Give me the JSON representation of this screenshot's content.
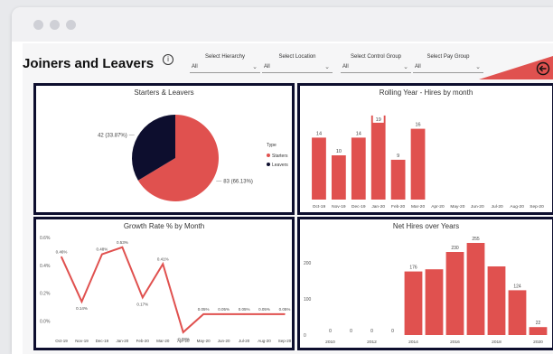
{
  "window": {
    "dot_colors": [
      "#cfd0d6",
      "#cfd0d6",
      "#cfd0d6"
    ]
  },
  "header": {
    "title": "Joiners and Leavers",
    "info_icon": "info-icon",
    "back_icon": "back-arrow-icon",
    "accent": "#e0514f"
  },
  "filters": [
    {
      "label": "Select Hierarchy",
      "value": "All"
    },
    {
      "label": "Select Location",
      "value": "All"
    },
    {
      "label": "Select Control Group",
      "value": "All"
    },
    {
      "label": "Select Pay Group",
      "value": "All"
    }
  ],
  "panels": {
    "starters": {
      "title": "Starters & Leavers",
      "legend_title": "Type"
    },
    "rolling": {
      "title": "Rolling Year - Hires by month"
    },
    "growth": {
      "title": "Growth Rate % by Month"
    },
    "net": {
      "title": "Net Hires over Years"
    }
  },
  "chart_data": [
    {
      "type": "pie",
      "title": "Starters & Leavers",
      "legend_title": "Type",
      "slices": [
        {
          "name": "Starters",
          "value": 83,
          "label": "83 (66.13%)",
          "color": "#e0514f"
        },
        {
          "name": "Leavers",
          "value": 42,
          "label": "42 (33.87%)",
          "color": "#0d0e2e"
        }
      ]
    },
    {
      "type": "bar",
      "title": "Rolling Year - Hires by month",
      "categories": [
        "Oct-19",
        "Nov-19",
        "Dec-19",
        "Jan-20",
        "Feb-20",
        "Mar-20",
        "Apr-20",
        "May-20",
        "Jun-20",
        "Jul-20",
        "Aug-20",
        "Sep-20"
      ],
      "values": [
        14,
        10,
        14,
        19,
        9,
        16,
        0,
        0,
        0,
        0,
        0,
        0
      ],
      "labels": [
        "14",
        "10",
        "14",
        "19",
        "9",
        "16",
        "",
        "",
        "",
        "",
        "",
        ""
      ],
      "ylim": [
        0,
        20
      ],
      "color": "#e0514f"
    },
    {
      "type": "line",
      "title": "Growth Rate % by Month",
      "categories": [
        "Oct-19",
        "Nov-19",
        "Dec-19",
        "Jan-20",
        "Feb-20",
        "Mar-20",
        "Apr-20",
        "May-20",
        "Jun-20",
        "Jul-20",
        "Aug-20",
        "Sep-20"
      ],
      "values": [
        0.46,
        0.14,
        0.48,
        0.53,
        0.17,
        0.41,
        -0.08,
        0.05,
        0.05,
        0.05,
        0.05,
        0.05
      ],
      "labels": [
        "0.46%",
        "0.14%",
        "0.48%",
        "0.53%",
        "0.17%",
        "0.41%",
        "-0.08%",
        "0.05%",
        "0.05%",
        "0.05%",
        "0.05%",
        "0.05%"
      ],
      "yticks": [
        "0.6%",
        "0.4%",
        "0.2%",
        "0.0%"
      ],
      "ytick_values": [
        0.6,
        0.4,
        0.2,
        0.0
      ],
      "ylim": [
        -0.1,
        0.6
      ],
      "color": "#e0514f"
    },
    {
      "type": "bar",
      "title": "Net Hires over Years",
      "categories": [
        "2010",
        "2011",
        "2012",
        "2013",
        "2014",
        "2015",
        "2016",
        "2017",
        "2018",
        "2019",
        "2020"
      ],
      "tick_labels": [
        "2010",
        "",
        "2012",
        "",
        "2014",
        "",
        "2016",
        "",
        "2018",
        "",
        "2020"
      ],
      "values": [
        0,
        0,
        0,
        0,
        176,
        182,
        230,
        255,
        190,
        124,
        22
      ],
      "labels": [
        "0",
        "0",
        "0",
        "0",
        "176",
        "",
        "230",
        "255",
        "",
        "124",
        "22"
      ],
      "yticks": [
        "200",
        "100",
        "0"
      ],
      "ytick_values": [
        200,
        100,
        0
      ],
      "ylim": [
        0,
        270
      ],
      "color": "#e0514f"
    }
  ]
}
